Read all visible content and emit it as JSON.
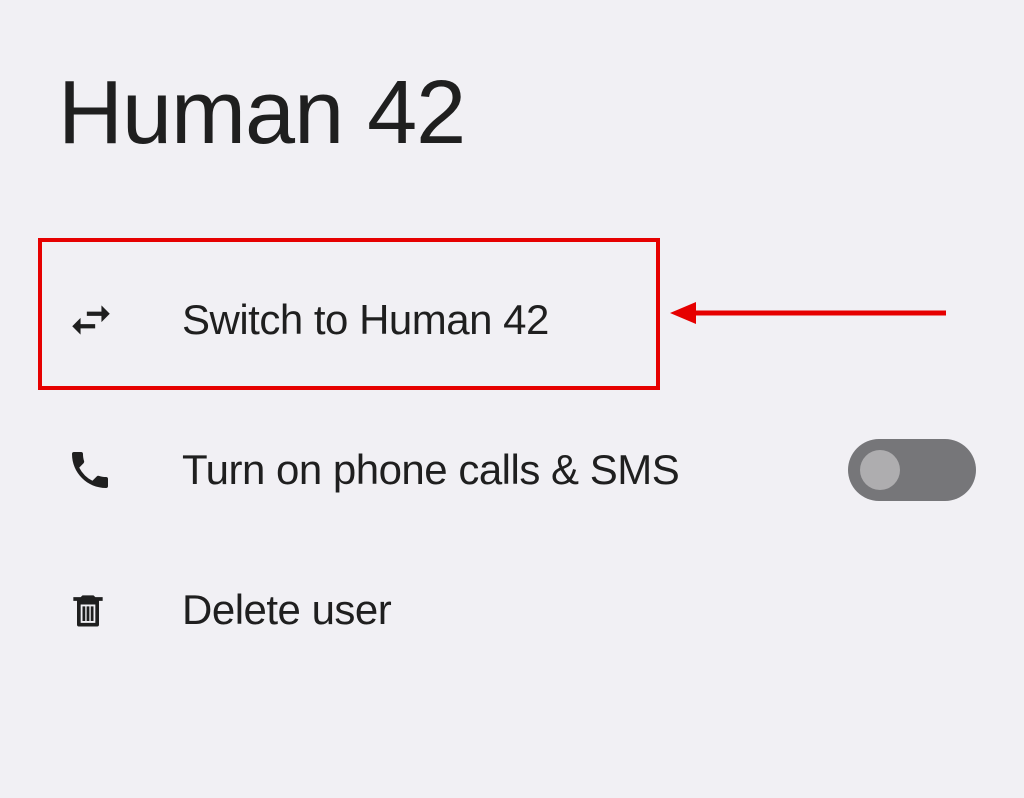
{
  "title": "Human 42",
  "items": {
    "switch_label": "Switch to Human 42",
    "phone_label": "Turn on phone calls & SMS",
    "delete_label": "Delete user"
  },
  "toggle": {
    "phone_sms_on": false
  },
  "annotation": {
    "highlight_target": "switch-user-item"
  },
  "colors": {
    "bg": "#f1f0f4",
    "text": "#1f1f1f",
    "toggle_track_off": "#767679",
    "toggle_knob_off": "#aeadaf",
    "highlight": "#e60000"
  }
}
